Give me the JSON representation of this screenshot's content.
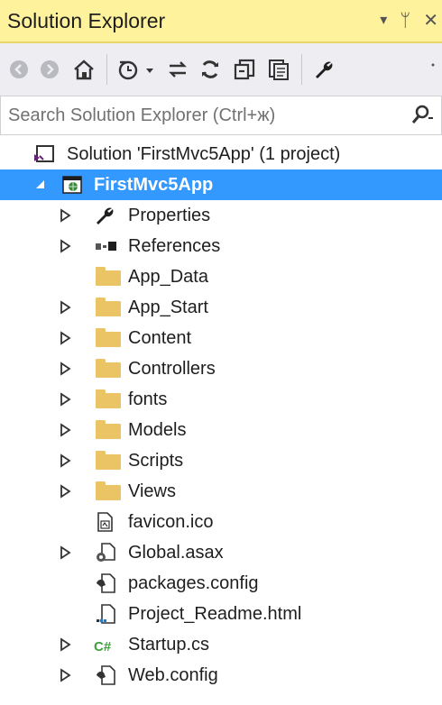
{
  "panel": {
    "title": "Solution Explorer",
    "controls": [
      "▾",
      "ᛘ",
      "✕"
    ]
  },
  "toolbar": {
    "buttons": [
      "back-icon",
      "forward-icon",
      "home-icon",
      "pending-changes-icon",
      "sync-icon",
      "refresh-icon",
      "collapse-all-icon",
      "show-all-files-icon",
      "properties-icon"
    ]
  },
  "search": {
    "placeholder": "Search Solution Explorer (Ctrl+ж)"
  },
  "colors": {
    "title_bg": "#fff29d",
    "selected_bg": "#3399ff",
    "folder": "#ebc466",
    "csharp": "#3f9f3f"
  },
  "tree": {
    "solution": "Solution 'FirstMvc5App' (1 project)",
    "project": "FirstMvc5App",
    "items": [
      {
        "label": "Properties",
        "icon": "wrench-icon",
        "expandable": true
      },
      {
        "label": "References",
        "icon": "references-icon",
        "expandable": true
      },
      {
        "label": "App_Data",
        "icon": "folder-icon",
        "expandable": false
      },
      {
        "label": "App_Start",
        "icon": "folder-icon",
        "expandable": true
      },
      {
        "label": "Content",
        "icon": "folder-icon",
        "expandable": true
      },
      {
        "label": "Controllers",
        "icon": "folder-icon",
        "expandable": true
      },
      {
        "label": "fonts",
        "icon": "folder-icon",
        "expandable": true
      },
      {
        "label": "Models",
        "icon": "folder-icon",
        "expandable": true
      },
      {
        "label": "Scripts",
        "icon": "folder-icon",
        "expandable": true
      },
      {
        "label": "Views",
        "icon": "folder-icon",
        "expandable": true
      },
      {
        "label": "favicon.ico",
        "icon": "image-file-icon",
        "expandable": false
      },
      {
        "label": "Global.asax",
        "icon": "asax-file-icon",
        "expandable": true
      },
      {
        "label": "packages.config",
        "icon": "config-file-icon",
        "expandable": false
      },
      {
        "label": "Project_Readme.html",
        "icon": "html-file-icon",
        "expandable": false
      },
      {
        "label": "Startup.cs",
        "icon": "csharp-file-icon",
        "expandable": true,
        "icon_text": "C#"
      },
      {
        "label": "Web.config",
        "icon": "config-file-icon",
        "expandable": true
      }
    ]
  }
}
